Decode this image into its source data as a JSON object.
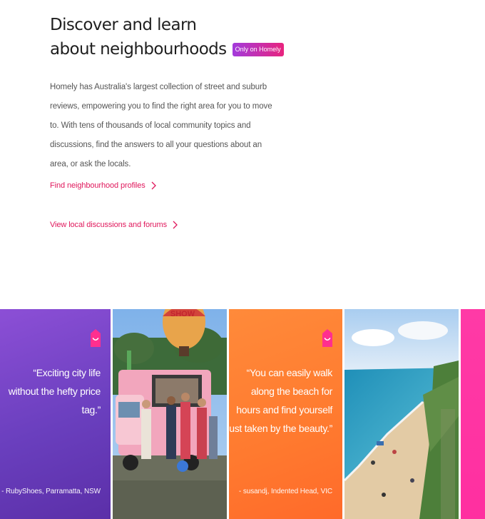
{
  "section": {
    "title_line1": "Discover and learn",
    "title_line2": "about neighbourhoods",
    "badge": "Only on Homely",
    "description": "Homely has Australia's largest collection of street and suburb reviews, empowering you to find the right area for you to move to. With tens of thousands of local community topics and discussions, find the answers to all your questions about an area, or ask the locals."
  },
  "links": {
    "profiles": "Find neighbourhood profiles",
    "forums": "View local discussions and forums"
  },
  "testimonials": [
    {
      "quote": "“Exciting city life without the hefty price tag.”",
      "author": "- RubyShoes, Parramatta, NSW",
      "color": "#6a3fbe"
    },
    {
      "quote": "“You can easily walk along the beach for hours and find yourself just taken by the beauty.”",
      "author": "- susandj, Indented Head, VIC",
      "color": "#ff7a2f"
    }
  ],
  "photos": {
    "balloon_text": "SHOW"
  },
  "colors": {
    "accent": "#e0185c",
    "badge_from": "#a33bdc",
    "badge_to": "#e8247e",
    "pink_card": "#ff2fa0"
  },
  "icons": [
    "chevron-right-icon",
    "homely-house-icon"
  ]
}
